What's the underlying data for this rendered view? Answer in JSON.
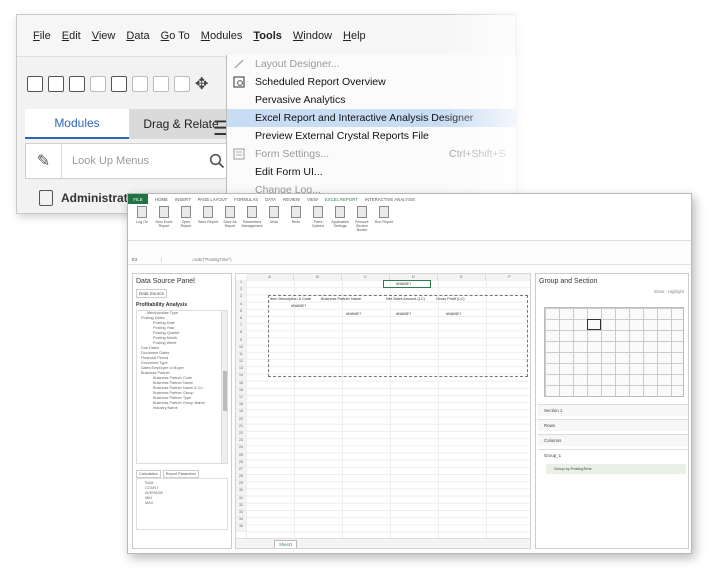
{
  "menubar": {
    "items": [
      "File",
      "Edit",
      "View",
      "Data",
      "Go To",
      "Modules",
      "Tools",
      "Window",
      "Help"
    ],
    "active": "Tools"
  },
  "sidebar": {
    "tabs": [
      "Modules",
      "Drag & Relate"
    ],
    "lookup_placeholder": "Look Up Menus",
    "admin_label": "Administration"
  },
  "tools_menu": {
    "items": [
      {
        "label": "Layout Designer...",
        "disabled": true,
        "highlighted": false,
        "shortcut": ""
      },
      {
        "label": "Scheduled Report Overview",
        "disabled": false,
        "highlighted": false,
        "shortcut": ""
      },
      {
        "label": "Pervasive Analytics",
        "disabled": false,
        "highlighted": false,
        "shortcut": ""
      },
      {
        "label": "Excel Report and Interactive Analysis Designer",
        "disabled": false,
        "highlighted": true,
        "shortcut": ""
      },
      {
        "label": "Preview External Crystal Reports File",
        "disabled": false,
        "highlighted": false,
        "shortcut": ""
      },
      {
        "label": "Form Settings...",
        "disabled": true,
        "highlighted": false,
        "shortcut": "Ctrl+Shift+S"
      },
      {
        "label": "Edit Form UI...",
        "disabled": false,
        "highlighted": false,
        "shortcut": ""
      },
      {
        "label": "Change Log...",
        "disabled": true,
        "highlighted": false,
        "shortcut": ""
      }
    ]
  },
  "excel": {
    "file_tab": "FILE",
    "ribbon_tabs": [
      "HOME",
      "INSERT",
      "PAGE LAYOUT",
      "FORMULAS",
      "DATA",
      "REVIEW",
      "VIEW",
      "EXCEL REPORT",
      "INTERACTIVE ANALYSIS"
    ],
    "current_ribbon_tab": "EXCEL REPORT",
    "ribbon_buttons": [
      "Log On",
      "New Excel Report",
      "Open Report",
      "Save Report",
      "Save As Report",
      "Parameters Management",
      "Undo",
      "Redo",
      "Fixed Options",
      "Application Settings",
      "Remove Section Border",
      "Run Report"
    ],
    "name_box": "E3",
    "formula": "=sobr(\"PostingTime\")",
    "data_source_panel": {
      "title": "Data Source Panel",
      "subtab": "Data Source",
      "analysis": "Profitability Analysis",
      "tree": [
        {
          "level": 2,
          "label": "Merchandise Type"
        },
        {
          "level": 1,
          "label": "Posting Dates"
        },
        {
          "level": 3,
          "label": "Posting Date"
        },
        {
          "level": 3,
          "label": "Posting Year"
        },
        {
          "level": 3,
          "label": "Posting Quarter"
        },
        {
          "level": 3,
          "label": "Posting Month"
        },
        {
          "level": 3,
          "label": "Posting Week"
        },
        {
          "level": 1,
          "label": "Due Dates"
        },
        {
          "level": 1,
          "label": "Document Dates"
        },
        {
          "level": 1,
          "label": "Financial Period"
        },
        {
          "level": 1,
          "label": "Document Type"
        },
        {
          "level": 1,
          "label": "Sales Employee or Buyer"
        },
        {
          "level": 1,
          "label": "Business Partner"
        },
        {
          "level": 3,
          "label": "Business Partner Code"
        },
        {
          "level": 3,
          "label": "Business Partner Name"
        },
        {
          "level": 3,
          "label": "Business Partner Name & Co"
        },
        {
          "level": 3,
          "label": "Business Partner Group"
        },
        {
          "level": 3,
          "label": "Business Partner Type"
        },
        {
          "level": 3,
          "label": "Business Partner Group Name"
        },
        {
          "level": 3,
          "label": "Industry Name"
        }
      ],
      "bottom_tabs": [
        "Calculation",
        "Report Parameter"
      ],
      "calculations": [
        "SUM",
        "COUNT",
        "AVERAGE",
        "MIN",
        "MAX"
      ]
    },
    "sheet": {
      "columns": [
        "A",
        "B",
        "C",
        "D",
        "E",
        "F"
      ],
      "rows": [
        "1",
        "2",
        "3",
        "4",
        "5",
        "6",
        "7",
        "8",
        "9",
        "10",
        "11",
        "12",
        "13",
        "14",
        "15",
        "16",
        "17",
        "18",
        "19",
        "20",
        "21",
        "22",
        "23",
        "24",
        "25",
        "26",
        "27",
        "28",
        "29",
        "30",
        "31",
        "32",
        "33",
        "34",
        "35"
      ],
      "headers": [
        "Item Description & Code",
        "Business Partner Name",
        "Net Sales Amount (LC)",
        "Gross Profit (LC)"
      ],
      "name_cell": "#NAME?",
      "row_values": [
        "#NAME?",
        "#NAME?",
        "#NAME?",
        "#NAME?"
      ],
      "sheet_tab": "Sheet1"
    },
    "group_section_panel": {
      "title": "Group and Section",
      "tools": [
        "Show",
        "Highlight"
      ],
      "mini_columns": [
        "A",
        "B",
        "C",
        "D",
        "E",
        "F",
        "G",
        "H",
        "I",
        "J"
      ],
      "mini_rows": [
        "1",
        "2",
        "3",
        "4",
        "5",
        "6",
        "7",
        "8"
      ],
      "sections": [
        "Section 1",
        "Rows",
        "Columns"
      ],
      "group_label": "Group_1",
      "group_chip": "Group by PostingTime"
    }
  }
}
